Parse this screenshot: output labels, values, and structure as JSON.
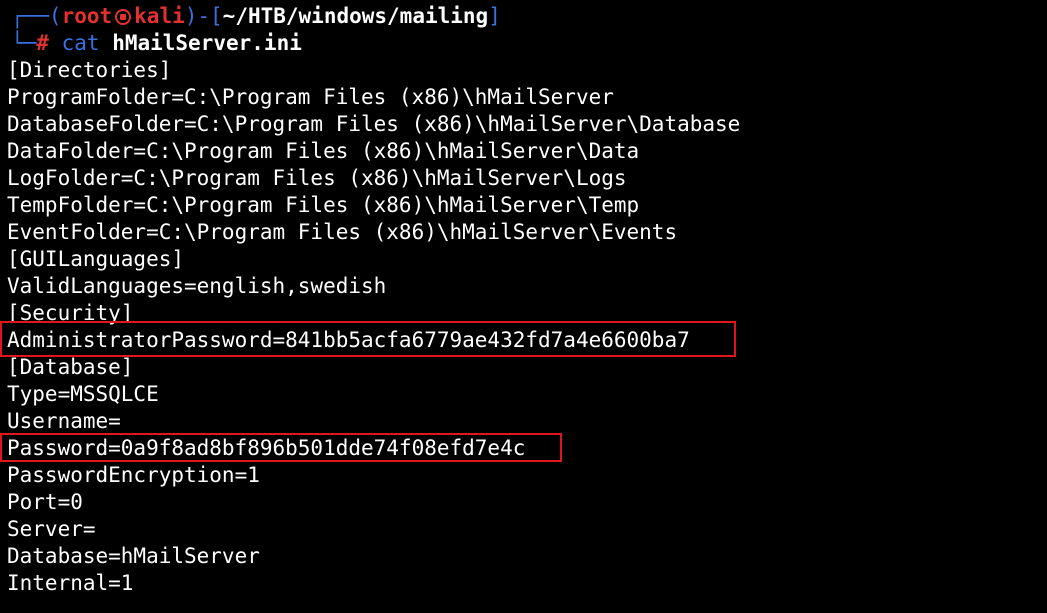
{
  "prompt": {
    "open_bracket": "┌──(",
    "user": "root",
    "host": "kali",
    "close_mid": ")-[",
    "path": "~/HTB/windows/mailing",
    "close_bracket": "]",
    "line2_prefix": "└─",
    "hash": "#",
    "command": "cat",
    "argument": "hMailServer.ini"
  },
  "output_lines": [
    "[Directories]",
    "ProgramFolder=C:\\Program Files (x86)\\hMailServer",
    "DatabaseFolder=C:\\Program Files (x86)\\hMailServer\\Database",
    "DataFolder=C:\\Program Files (x86)\\hMailServer\\Data",
    "LogFolder=C:\\Program Files (x86)\\hMailServer\\Logs",
    "TempFolder=C:\\Program Files (x86)\\hMailServer\\Temp",
    "EventFolder=C:\\Program Files (x86)\\hMailServer\\Events",
    "[GUILanguages]",
    "ValidLanguages=english,swedish",
    "[Security]",
    "AdministratorPassword=841bb5acfa6779ae432fd7a4e6600ba7",
    "[Database]",
    "Type=MSSQLCE",
    "Username=",
    "Password=0a9f8ad8bf896b501dde74f08efd7e4c",
    "PasswordEncryption=1",
    "Port=0",
    "Server=",
    "Database=hMailServer",
    "Internal=1"
  ],
  "colors": {
    "background": "#000000",
    "prompt_blue": "#3b6fe0",
    "prompt_red": "#e3312f",
    "highlight_red": "#e0161c",
    "text": "#ffffff"
  },
  "icons": {
    "host_separator": "kali-skull-icon"
  }
}
